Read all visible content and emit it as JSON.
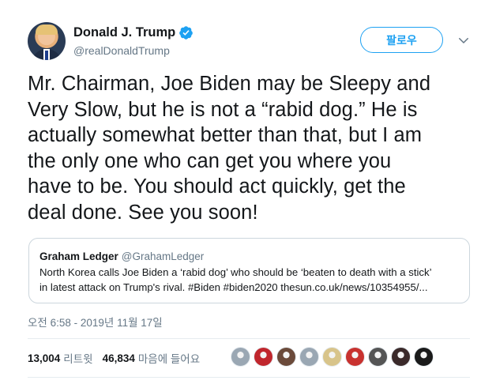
{
  "author": {
    "display_name": "Donald J. Trump",
    "handle": "@realDonaldTrump",
    "verified": true,
    "verified_icon": "verified-badge-icon"
  },
  "actions": {
    "follow_label": "팔로우",
    "caret_icon": "chevron-down-icon"
  },
  "tweet": {
    "lines": [
      "Mr. Chairman, Joe Biden may be Sleepy and",
      "Very Slow, but he is not a “rabid dog.” He is",
      "actually somewhat better than that, but I am",
      "the only one who can get you where you",
      "have to be. You should act quickly, get the",
      "deal done. See you soon!"
    ],
    "timestamp": "오전 6:58 - 2019년 11월 17일"
  },
  "quoted_tweet": {
    "display_name": "Graham Ledger",
    "handle": "@GrahamLedger",
    "body_lines": [
      "North Korea calls Joe Biden a ‘rabid dog’ who should be ‘beaten to death with a stick’",
      "in latest attack on Trump's rival. #Biden #biden2020  thesun.co.uk/news/10354955/..."
    ]
  },
  "stats": {
    "retweets_count": "13,004",
    "retweets_label": "리트윗",
    "likes_count": "46,834",
    "likes_label": "마음에 들어요"
  },
  "likers": [
    {
      "name": "liker-avatar-1",
      "color": "#9aa7b3"
    },
    {
      "name": "liker-avatar-2",
      "color": "#c0262d"
    },
    {
      "name": "liker-avatar-3",
      "color": "#6b4a3a"
    },
    {
      "name": "liker-avatar-4",
      "color": "#9aa7b3"
    },
    {
      "name": "liker-avatar-5",
      "color": "#d8c48a"
    },
    {
      "name": "liker-avatar-6",
      "color": "#c8322f"
    },
    {
      "name": "liker-avatar-7",
      "color": "#555555"
    },
    {
      "name": "liker-avatar-8",
      "color": "#3b2a2a"
    },
    {
      "name": "liker-avatar-9",
      "color": "#1a1a1a"
    }
  ],
  "colors": {
    "accent": "#1da1f2",
    "text": "#14171a",
    "secondary_text": "#657786",
    "border": "#ccd6dd"
  }
}
